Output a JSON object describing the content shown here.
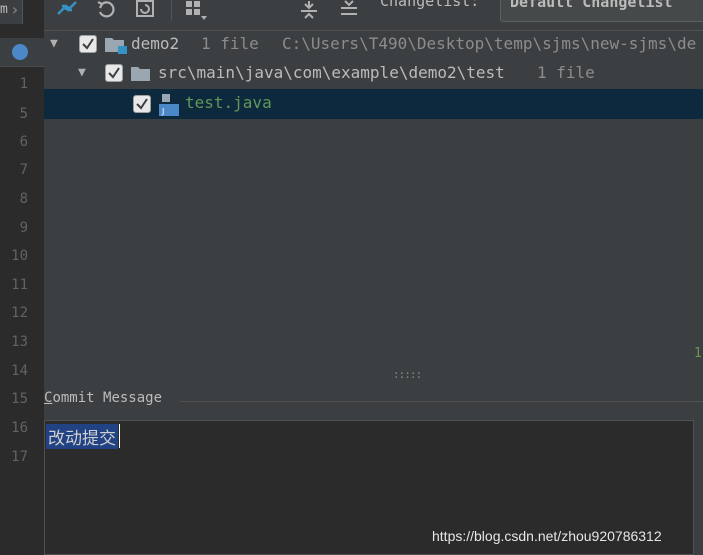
{
  "editor": {
    "breadcrumb_text": "m",
    "line_numbers": [
      "1",
      "5",
      "6",
      "7",
      "8",
      "9",
      "10",
      "11",
      "12",
      "13",
      "14",
      "15",
      "16",
      "17"
    ]
  },
  "toolbar": {
    "icons": [
      "merge-arrows-icon",
      "rollback-icon",
      "refresh-icon",
      "group-by-icon",
      "expand-all-icon",
      "collapse-all-icon"
    ],
    "changelist_label": "Changelist:",
    "changelist_value": "Default Changelist"
  },
  "tree": {
    "root": {
      "name": "demo2",
      "count": "1 file",
      "path": "C:\\Users\\T490\\Desktop\\temp\\sjms\\new-sjms\\de",
      "checked": true,
      "expanded": true
    },
    "folder": {
      "name": "src\\main\\java\\com\\example\\demo2\\test",
      "count": "1 file",
      "checked": true,
      "expanded": true
    },
    "file": {
      "name": "test.java",
      "checked": true,
      "selected": true,
      "color": "#629755"
    }
  },
  "status_number": "1",
  "commit": {
    "label": "Commit Message",
    "label_mnemonic": "C",
    "label_rest": "ommit Message",
    "message": "改动提交"
  },
  "watermark": "https://blog.csdn.net/zhou920786312",
  "colors": {
    "selection": "#0d293e",
    "text_selection": "#214283",
    "accent_green": "#629755",
    "folder_blue": "#4a88c7"
  }
}
